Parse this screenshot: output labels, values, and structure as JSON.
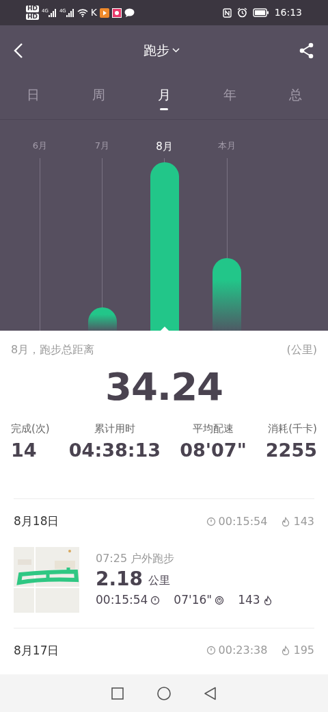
{
  "status_bar": {
    "sim_badges": [
      "HD",
      "HD"
    ],
    "networks": [
      "4G",
      "4G"
    ],
    "app_letter": "K",
    "time": "16:13"
  },
  "header": {
    "title": "跑步"
  },
  "tabs": [
    {
      "label": "日",
      "selected": false
    },
    {
      "label": "周",
      "selected": false
    },
    {
      "label": "月",
      "selected": true
    },
    {
      "label": "年",
      "selected": false
    },
    {
      "label": "总",
      "selected": false
    }
  ],
  "months": [
    {
      "label": "6月",
      "level": 0,
      "selected": false
    },
    {
      "label": "7月",
      "level": 0.14,
      "selected": false
    },
    {
      "label": "8月",
      "level": 1,
      "selected": true
    },
    {
      "label": "本月",
      "level": 0.43,
      "selected": false
    }
  ],
  "summary": {
    "title": "8月，跑步总距离",
    "unit": "(公里)",
    "total": "34.24",
    "stats": [
      {
        "label": "完成(次)",
        "value": "14"
      },
      {
        "label": "累计用时",
        "value": "04:38:13"
      },
      {
        "label": "平均配速",
        "value": "08'07\""
      },
      {
        "label": "消耗(千卡)",
        "value": "2255"
      }
    ]
  },
  "days": [
    {
      "date": "8月18日",
      "duration": "00:15:54",
      "calories": "143",
      "runs": [
        {
          "time_type": "07:25 户外跑步",
          "distance": "2.18",
          "unit": "公里",
          "duration": "00:15:54",
          "pace": "07'16\"",
          "calories": "143"
        }
      ]
    },
    {
      "date": "8月17日",
      "duration": "00:23:38",
      "calories": "195"
    }
  ]
}
